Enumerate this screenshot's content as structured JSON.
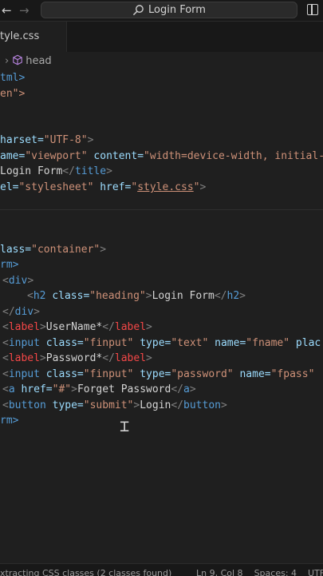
{
  "titlebar": {
    "search_label": "Login Form"
  },
  "tabs": [
    {
      "label": "tyle.css"
    }
  ],
  "breadcrumbs": {
    "items": [
      "head"
    ]
  },
  "code": {
    "l1": "tml>",
    "l2_attr": "en\">",
    "l3_attr": "harset=",
    "l3_str": "\"UTF-8\"",
    "l4_attr1": "ame=",
    "l4_str1": "\"viewport\"",
    "l4_attr2": "content=",
    "l4_str2": "\"width=device-width, initial-",
    "l5_text": "Login Form",
    "l6_attr1": "el=",
    "l6_str1": "\"stylesheet\"",
    "l6_attr2": "href=",
    "l6_str2": "style.css",
    "l7_attr": "lass=",
    "l7_str": "\"container\"",
    "l8": "rm>",
    "h2_class": "class=",
    "h2_class_val": "\"heading\"",
    "h2_text": "Login Form",
    "label1_text": "UserName*",
    "input1_attrs": "class=",
    "input1_class": "\"finput\"",
    "input1_type_attr": "type=",
    "input1_type": "\"text\"",
    "input1_name_attr": "name=",
    "input1_name": "\"fname\"",
    "input1_tail": "plac",
    "label2_text": "Password*",
    "input2_type": "\"password\"",
    "input2_name": "\"fpass\"",
    "a_href_attr": "href=",
    "a_href": "\"#\"",
    "a_text": "Forget Password",
    "button_type_attr": "type=",
    "button_type": "\"submit\"",
    "button_text": "Login",
    "l_end": "rm>"
  },
  "statusbar": {
    "left": "xtracting CSS classes (2 classes found)",
    "position": "Ln 9, Col 8",
    "spaces": "Spaces: 4",
    "encoding": "UTF-"
  }
}
